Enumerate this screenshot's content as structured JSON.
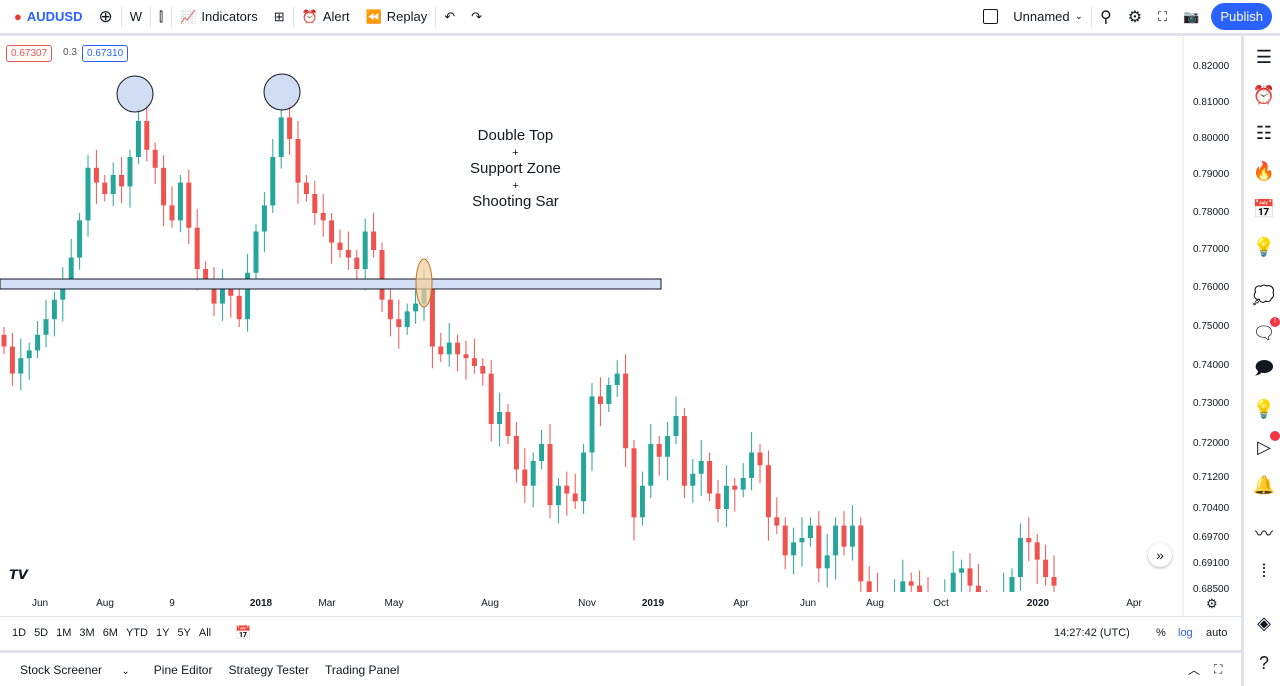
{
  "toolbar": {
    "symbol": "AUDUSD",
    "interval": "W",
    "indicators": "Indicators",
    "alert": "Alert",
    "replay": "Replay",
    "layout_name": "Unnamed",
    "publish": "Publish"
  },
  "quote": {
    "bid": "0.67307",
    "spread": "0.3",
    "ask": "0.67310"
  },
  "annotation": {
    "line1": "Double Top",
    "line2": "+",
    "line3": "Support Zone",
    "line4": "+",
    "line5": "Shooting Sar"
  },
  "colors": {
    "up": "#26a69a",
    "down": "#ef5350",
    "accent": "#2962ff",
    "zone": "#d4e0f7",
    "circle": "#c5d3f3",
    "highlight": "#f5cf9c"
  },
  "chart_data": {
    "type": "candlestick",
    "symbol": "AUDUSD",
    "interval": "W",
    "scale": "log",
    "price_ticks": [
      "0.82000",
      "0.81000",
      "0.80000",
      "0.79000",
      "0.78000",
      "0.77000",
      "0.76000",
      "0.75000",
      "0.74000",
      "0.73000",
      "0.72000",
      "0.71200",
      "0.70400",
      "0.69700",
      "0.69100",
      "0.68500"
    ],
    "time_ticks": [
      "Jun",
      "Aug",
      "9",
      "2018",
      "Mar",
      "May",
      "Aug",
      "Nov",
      "2019",
      "Apr",
      "Jun",
      "Aug",
      "Oct",
      "2020",
      "Apr"
    ],
    "closes": [
      0.745,
      0.738,
      0.742,
      0.744,
      0.748,
      0.752,
      0.757,
      0.762,
      0.768,
      0.778,
      0.792,
      0.788,
      0.785,
      0.79,
      0.787,
      0.795,
      0.805,
      0.797,
      0.792,
      0.782,
      0.778,
      0.788,
      0.776,
      0.765,
      0.762,
      0.756,
      0.76,
      0.758,
      0.752,
      0.764,
      0.775,
      0.782,
      0.795,
      0.806,
      0.8,
      0.788,
      0.785,
      0.78,
      0.778,
      0.772,
      0.77,
      0.768,
      0.765,
      0.775,
      0.77,
      0.757,
      0.752,
      0.75,
      0.754,
      0.756,
      0.76,
      0.745,
      0.743,
      0.746,
      0.743,
      0.742,
      0.74,
      0.738,
      0.725,
      0.728,
      0.722,
      0.714,
      0.71,
      0.716,
      0.72,
      0.705,
      0.71,
      0.708,
      0.706,
      0.718,
      0.732,
      0.73,
      0.735,
      0.738,
      0.719,
      0.702,
      0.71,
      0.72,
      0.717,
      0.722,
      0.727,
      0.71,
      0.713,
      0.716,
      0.708,
      0.704,
      0.71,
      0.709,
      0.712,
      0.718,
      0.715,
      0.702,
      0.7,
      0.693,
      0.696,
      0.697,
      0.7,
      0.69,
      0.693,
      0.7,
      0.695,
      0.7,
      0.687,
      0.684,
      0.682,
      0.68,
      0.684,
      0.687,
      0.686,
      0.683,
      0.681,
      0.68,
      0.684,
      0.689,
      0.69,
      0.686,
      0.683,
      0.68,
      0.681,
      0.684,
      0.688,
      0.697,
      0.696,
      0.692,
      0.688,
      0.686
    ]
  },
  "bottom": {
    "ranges": [
      "1D",
      "5D",
      "1M",
      "3M",
      "6M",
      "YTD",
      "1Y",
      "5Y",
      "All"
    ],
    "clock": "14:27:42 (UTC)",
    "pct": "%",
    "log": "log",
    "auto": "auto"
  },
  "footer": {
    "tabs": [
      "Stock Screener",
      "Pine Editor",
      "Strategy Tester",
      "Trading Panel"
    ]
  }
}
